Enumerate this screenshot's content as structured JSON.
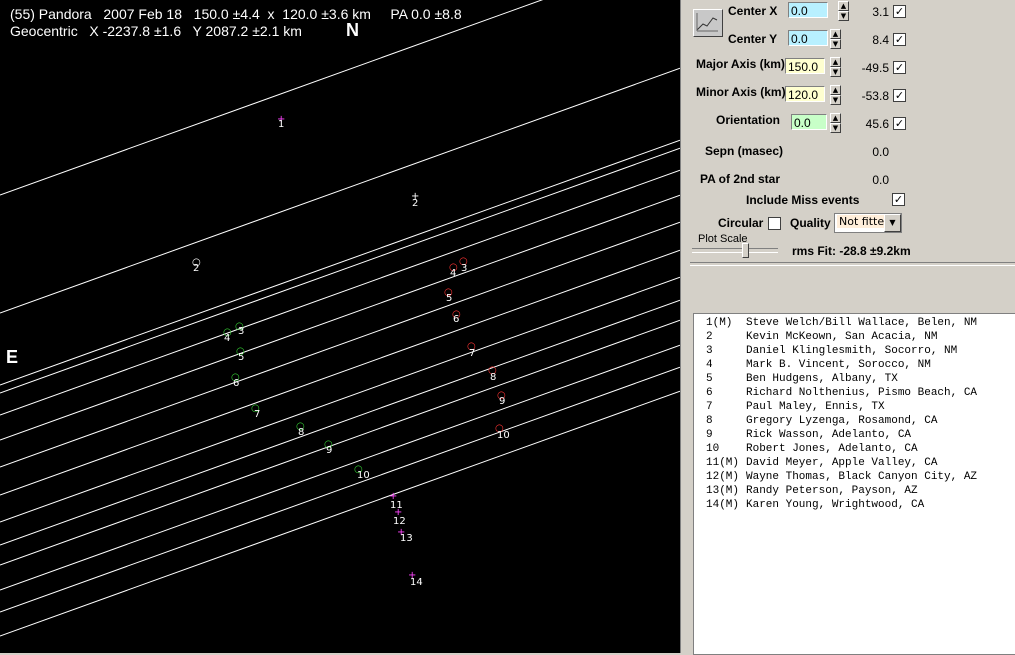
{
  "plot": {
    "header_line1": "(55) Pandora   2007 Feb 18   150.0 ±4.4  x  120.0 ±3.6 km     PA 0.0 ±8.8",
    "header_line2": "Geocentric   X -2237.8 ±1.6   Y 2087.2 ±2.1 km",
    "north_label": "N",
    "east_label": "E",
    "chords": [
      {
        "label": "1",
        "status": "miss"
      },
      {
        "label": "2",
        "status": "hit"
      },
      {
        "label": "3",
        "status": "hit"
      },
      {
        "label": "4",
        "status": "hit"
      },
      {
        "label": "5",
        "status": "hit"
      },
      {
        "label": "6",
        "status": "hit"
      },
      {
        "label": "7",
        "status": "hit"
      },
      {
        "label": "8",
        "status": "hit"
      },
      {
        "label": "9",
        "status": "hit"
      },
      {
        "label": "10",
        "status": "hit"
      },
      {
        "label": "11",
        "status": "miss"
      },
      {
        "label": "12",
        "status": "miss"
      },
      {
        "label": "13",
        "status": "miss"
      },
      {
        "label": "14",
        "status": "miss"
      }
    ],
    "colors": {
      "background": "#000000",
      "line": "#ffffff",
      "miss_marker": "#ff44ff",
      "start_marker": "#33cc33",
      "end_marker": "#ff3333"
    }
  },
  "panel": {
    "center_x": {
      "label": "Center X",
      "value": "0.0",
      "fit": "3.1",
      "checked": true
    },
    "center_y": {
      "label": "Center Y",
      "value": "0.0",
      "fit": "8.4",
      "checked": true
    },
    "major_axis": {
      "label": "Major Axis (km)",
      "value": "150.0",
      "fit": "-49.5",
      "checked": true
    },
    "minor_axis": {
      "label": "Minor Axis (km)",
      "value": "120.0",
      "fit": "-53.8",
      "checked": true
    },
    "orientation": {
      "label": "Orientation",
      "value": "0.0",
      "fit": "45.6",
      "checked": true
    },
    "sepn": {
      "label": "Sepn (masec)",
      "value": "0.0"
    },
    "pa2": {
      "label": "PA of 2nd star",
      "value": "0.0"
    },
    "include_miss": {
      "label": "Include Miss events",
      "checked": true
    },
    "circular": {
      "label": "Circular",
      "checked": false
    },
    "quality": {
      "label": "Quality",
      "value": "Not fitted"
    },
    "plot_scale": {
      "label": "Plot Scale"
    },
    "rms_fit": "rms Fit: -28.8 ±9.2km",
    "colors": {
      "x_input": "#b8f0ff",
      "axis_input": "#ffffd0",
      "orient_input": "#c8ffc8"
    }
  },
  "observers": [
    {
      "num": "1(M)",
      "name": "Steve Welch/Bill Wallace, Belen, NM"
    },
    {
      "num": "2",
      "name": "Kevin McKeown, San Acacia, NM"
    },
    {
      "num": "3",
      "name": "Daniel Klinglesmith, Socorro, NM"
    },
    {
      "num": "4",
      "name": "Mark B. Vincent, Sorocco, NM"
    },
    {
      "num": "5",
      "name": "Ben Hudgens, Albany, TX"
    },
    {
      "num": "6",
      "name": "Richard Nolthenius, Pismo Beach, CA"
    },
    {
      "num": "7",
      "name": "Paul Maley, Ennis, TX"
    },
    {
      "num": "8",
      "name": "Gregory Lyzenga, Rosamond, CA"
    },
    {
      "num": "9",
      "name": "Rick Wasson, Adelanto, CA"
    },
    {
      "num": "10",
      "name": "Robert Jones, Adelanto, CA"
    },
    {
      "num": "11(M)",
      "name": "David Meyer, Apple Valley, CA"
    },
    {
      "num": "12(M)",
      "name": "Wayne Thomas, Black Canyon City, AZ"
    },
    {
      "num": "13(M)",
      "name": "Randy Peterson, Payson, AZ"
    },
    {
      "num": "14(M)",
      "name": "Karen Young, Wrightwood, CA"
    }
  ]
}
